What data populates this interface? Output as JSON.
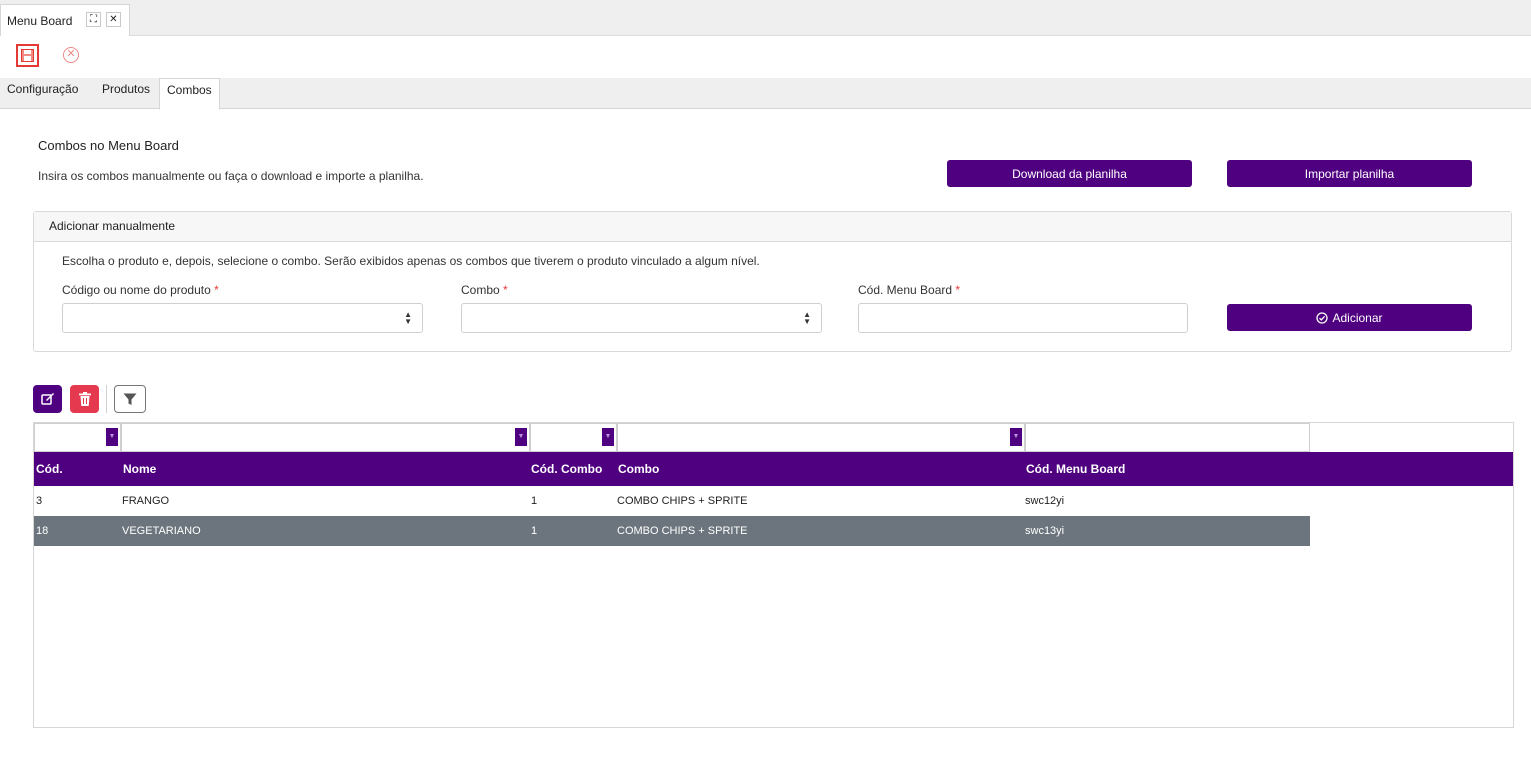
{
  "window": {
    "tab_title": "Menu Board",
    "expand_icon": "expand-icon",
    "close_icon": "close-icon"
  },
  "toolbar": {
    "save_icon": "save-icon",
    "cancel_icon": "cancel-icon"
  },
  "tabs": [
    {
      "label": "Configuração"
    },
    {
      "label": "Produtos"
    },
    {
      "label": "Combos"
    }
  ],
  "active_tab": "Combos",
  "section": {
    "title": "Combos no Menu Board",
    "description": "Insira os combos manualmente ou faça o download e importe a planilha.",
    "download_label": "Download da planilha",
    "import_label": "Importar planilha"
  },
  "manual": {
    "title": "Adicionar manualmente",
    "description": "Escolha o produto e, depois, selecione o combo. Serão exibidos apenas os combos que tiverem o produto vinculado a algum nível.",
    "product_label": "Código ou nome do produto",
    "combo_label": "Combo",
    "code_label": "Cód. Menu Board",
    "required_mark": "*",
    "add_label": "Adicionar"
  },
  "grid": {
    "columns": [
      "Cód.",
      "Nome",
      "Cód. Combo",
      "Combo",
      "Cód. Menu Board"
    ],
    "rows": [
      {
        "cod": "3",
        "nome": "FRANGO",
        "cod_combo": "1",
        "combo": "COMBO CHIPS + SPRITE",
        "cod_menu": "swc12yi"
      },
      {
        "cod": "18",
        "nome": "VEGETARIANO",
        "cod_combo": "1",
        "combo": "COMBO CHIPS + SPRITE",
        "cod_menu": "swc13yi"
      }
    ],
    "selected_row": 1
  },
  "colors": {
    "primary": "#4f0080",
    "danger": "#e53950",
    "selected_row": "#6c757d"
  }
}
